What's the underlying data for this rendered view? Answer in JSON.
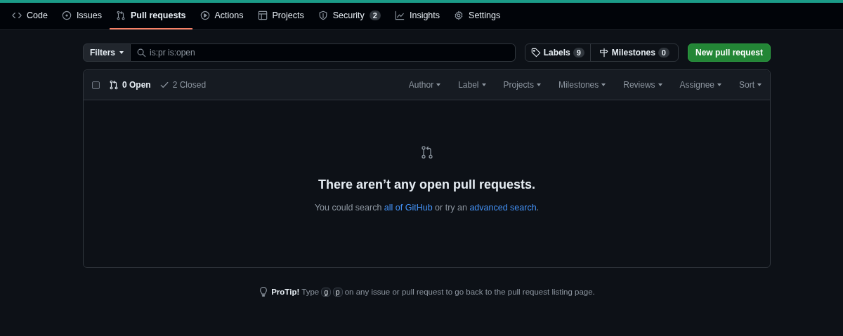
{
  "tabs": [
    {
      "kind": "code",
      "label": "Code",
      "selected": false
    },
    {
      "kind": "issue",
      "label": "Issues",
      "selected": false
    },
    {
      "kind": "pr",
      "label": "Pull requests",
      "selected": true
    },
    {
      "kind": "play",
      "label": "Actions",
      "selected": false
    },
    {
      "kind": "table",
      "label": "Projects",
      "selected": false
    },
    {
      "kind": "shield",
      "label": "Security",
      "counter": "2",
      "selected": false
    },
    {
      "kind": "graph",
      "label": "Insights",
      "selected": false
    },
    {
      "kind": "gear",
      "label": "Settings",
      "selected": false
    }
  ],
  "toolbar": {
    "filters": "Filters",
    "search": {
      "value": "is:pr is:open"
    },
    "labels": {
      "label": "Labels",
      "count": "9"
    },
    "milestones": {
      "label": "Milestones",
      "count": "0"
    },
    "new_button": "New pull request"
  },
  "list": {
    "select_all": {
      "checked": false
    },
    "states": [
      {
        "kind": "pr",
        "label": "0 Open",
        "selected": true
      },
      {
        "kind": "check",
        "label": "2 Closed",
        "selected": false
      }
    ],
    "filters": [
      "Author",
      "Label",
      "Projects",
      "Milestones",
      "Reviews",
      "Assignee",
      "Sort"
    ],
    "empty": {
      "title": "There aren’t any open pull requests.",
      "hint": [
        {
          "kind": "text",
          "text": "You could search "
        },
        {
          "kind": "link",
          "text": "all of GitHub"
        },
        {
          "kind": "text",
          "text": " or try an "
        },
        {
          "kind": "link",
          "text": "advanced search"
        },
        {
          "kind": "text",
          "text": "."
        }
      ]
    }
  },
  "protip": [
    {
      "kind": "bold",
      "text": "ProTip!"
    },
    {
      "kind": "text",
      "text": " Type "
    },
    {
      "kind": "key",
      "text": "g"
    },
    {
      "kind": "key",
      "text": "p"
    },
    {
      "kind": "text",
      "text": " on any issue or pull request to go back to the pull request listing page."
    }
  ]
}
